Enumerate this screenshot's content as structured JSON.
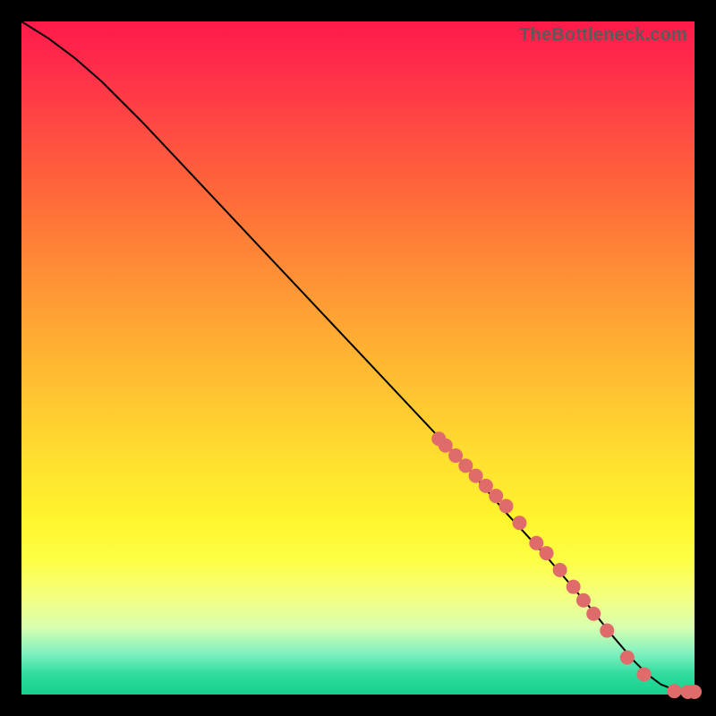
{
  "watermark": "TheBottleneck.com",
  "chart_data": {
    "type": "line",
    "title": "",
    "xlabel": "",
    "ylabel": "",
    "xlim": [
      0,
      100
    ],
    "ylim": [
      0,
      100
    ],
    "grid": false,
    "legend": false,
    "series": [
      {
        "name": "curve",
        "x": [
          0,
          4,
          8,
          12,
          18,
          26,
          34,
          42,
          50,
          58,
          66,
          72,
          78,
          84,
          88,
          91,
          93,
          95,
          97,
          99,
          100
        ],
        "y": [
          100,
          97.5,
          94.5,
          91,
          85,
          76.5,
          68,
          59.5,
          51,
          42.5,
          34,
          27,
          20.5,
          13.5,
          8.5,
          5,
          3,
          1.5,
          0.7,
          0.4,
          0.4
        ]
      }
    ],
    "points": {
      "name": "data-dots",
      "x": [
        62,
        63,
        64.5,
        66,
        67.5,
        69,
        70.5,
        72,
        74,
        76.5,
        78,
        80,
        82,
        83.5,
        85,
        87,
        90,
        92.5,
        97,
        99,
        100
      ],
      "y": [
        38,
        37,
        35.5,
        34,
        32.5,
        31,
        29.5,
        28,
        25.5,
        22.5,
        21,
        18.5,
        16,
        14,
        12,
        9.5,
        5.5,
        3,
        0.5,
        0.4,
        0.4
      ]
    }
  }
}
